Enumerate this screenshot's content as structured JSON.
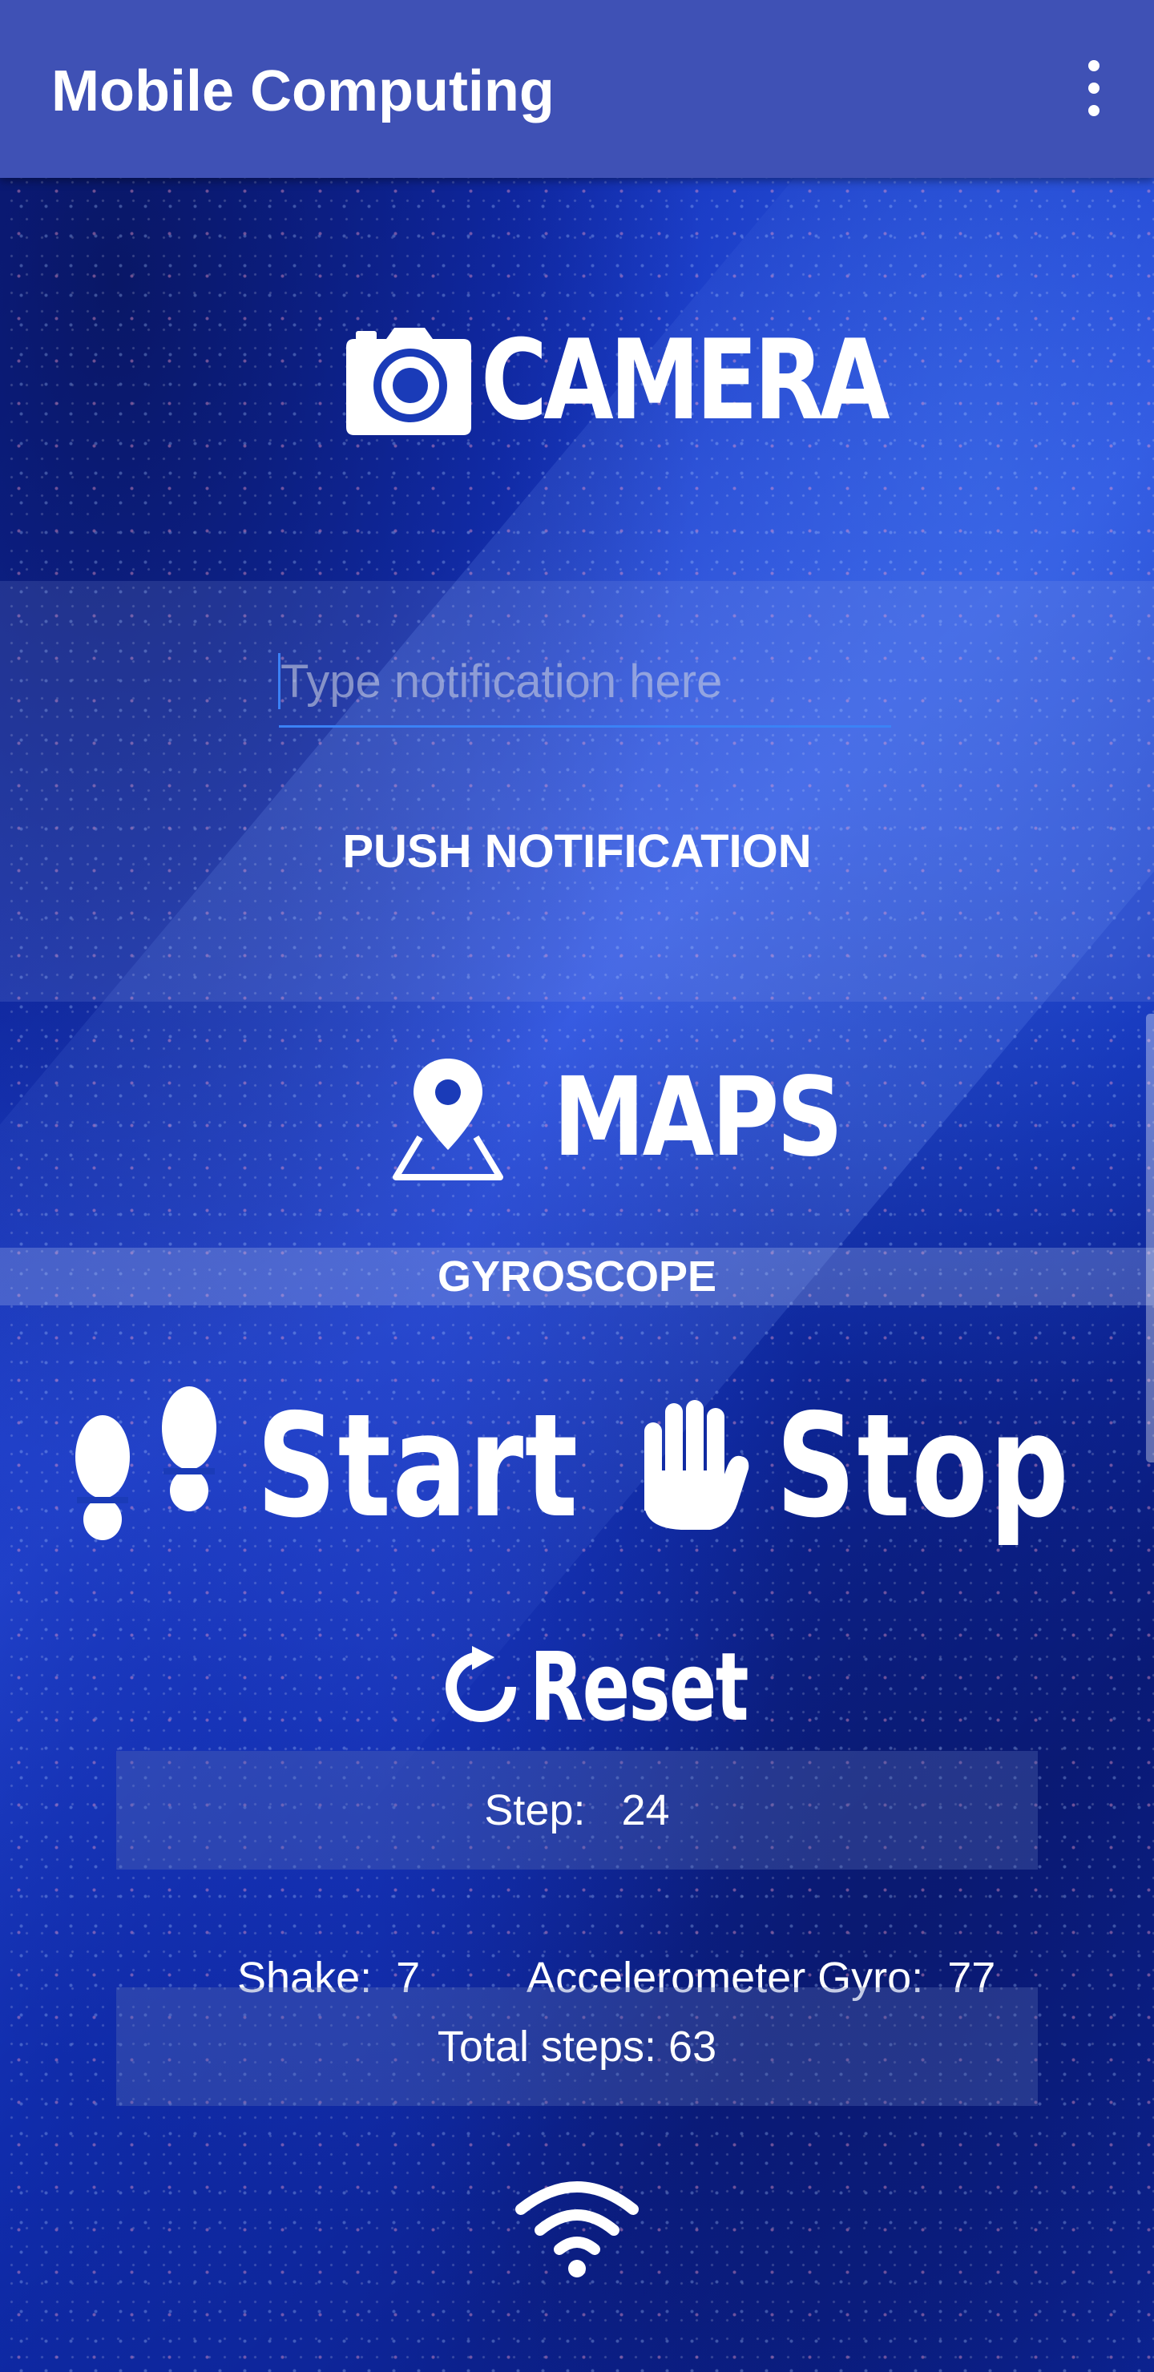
{
  "app_bar": {
    "title": "Mobile Computing",
    "menu_icon": "more-vert-icon",
    "background": "#3f51b5"
  },
  "camera": {
    "label": "CAMERA",
    "icon": "camera-icon"
  },
  "notification": {
    "input_placeholder": "Type notification here",
    "input_value": "",
    "push_label": "PUSH NOTIFICATION",
    "underline_color": "#3b82f6"
  },
  "maps": {
    "label": "MAPS",
    "icon": "map-pin-icon"
  },
  "gyroscope": {
    "label": "GYROSCOPE"
  },
  "steps_controls": {
    "start_label": "Start",
    "start_icon": "footprints-icon",
    "stop_label": "Stop",
    "stop_icon": "hand-stop-icon",
    "reset_label": "Reset",
    "reset_icon": "refresh-icon"
  },
  "stats": {
    "step_label": "Step:",
    "step_value": "24",
    "shake_label": "Shake:",
    "shake_value": "7",
    "accel_label": "Accelerometer Gyro:",
    "accel_value": "77",
    "total_label": "Total steps:",
    "total_value": "63"
  },
  "wifi": {
    "icon": "wifi-icon"
  }
}
